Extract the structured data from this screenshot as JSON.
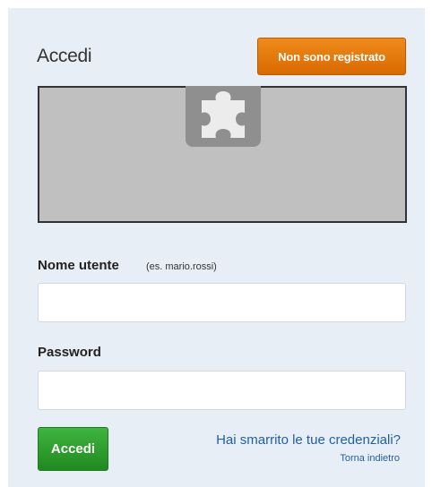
{
  "login": {
    "title": "Accedi",
    "register_label": "Non sono registrato",
    "username_label": "Nome utente",
    "username_hint": "(es. mario.rossi)",
    "username_value": "",
    "password_label": "Password",
    "password_value": "",
    "submit_label": "Accedi",
    "forgot_label": "Hai smarrito le tue credenziali?",
    "back_label": "Torna indietro"
  },
  "plugin": {
    "icon": "puzzle-piece-icon"
  },
  "colors": {
    "panel_bg": "#e8eef6",
    "register_orange": "#e57a10",
    "login_green": "#2e9e2e",
    "link_blue": "#1f5fa8",
    "plugin_gray": "#c0c0c0"
  }
}
